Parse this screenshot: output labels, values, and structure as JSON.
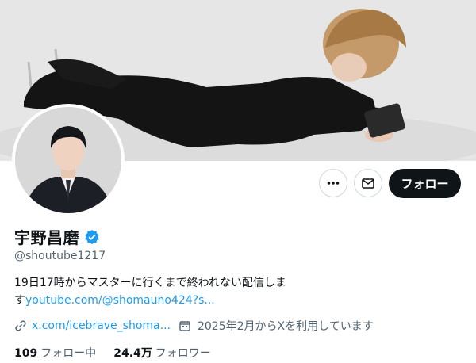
{
  "profile": {
    "display_name": "宇野昌磨",
    "handle": "@shoutube1217",
    "bio_text": "19日17時からマスターに行くまで終われない配信しま",
    "bio_text_cont": "す",
    "bio_link": "youtube.com/@shomauno424?s...",
    "website": "x.com/icebrave_shoma...",
    "joined": "2025年2月からXを利用しています",
    "following_count": "109",
    "following_label": "フォロー中",
    "followers_count": "24.4万",
    "followers_label": "フォロワー"
  },
  "actions": {
    "follow_label": "フォロー",
    "more_icon": "more-horizontal-icon",
    "message_icon": "envelope-icon"
  },
  "colors": {
    "accent": "#1d9bf0",
    "text_primary": "#0f1419",
    "text_secondary": "#536471",
    "button_dark": "#0f1419"
  }
}
